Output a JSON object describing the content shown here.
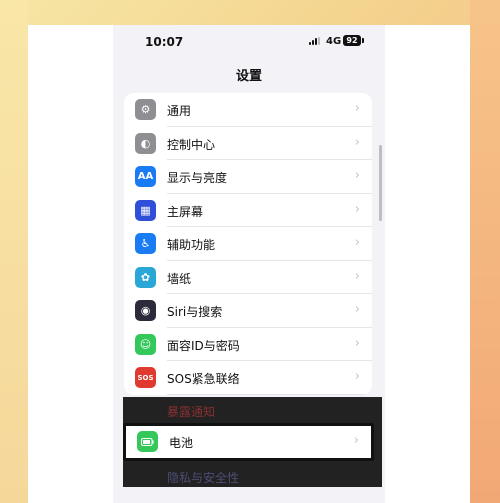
{
  "status": {
    "time": "10:07",
    "network": "4G",
    "battery": "92"
  },
  "nav": {
    "title": "设置"
  },
  "rows": [
    {
      "label": "通用",
      "icon": "gear-icon",
      "color": "#8e8e93",
      "glyph": "⚙"
    },
    {
      "label": "控制中心",
      "icon": "control-center-icon",
      "color": "#8e8e93",
      "glyph": "◐"
    },
    {
      "label": "显示与亮度",
      "icon": "display-brightness-icon",
      "color": "#1a7cf5",
      "glyph": "AA"
    },
    {
      "label": "主屏幕",
      "icon": "home-screen-icon",
      "color": "#2f4fd8",
      "glyph": "▦"
    },
    {
      "label": "辅助功能",
      "icon": "accessibility-icon",
      "color": "#1a7cf5",
      "glyph": "♿"
    },
    {
      "label": "墙纸",
      "icon": "wallpaper-icon",
      "color": "#2aa7d6",
      "glyph": "✿"
    },
    {
      "label": "Siri与搜索",
      "icon": "siri-icon",
      "color": "#2b2b3c",
      "glyph": "◉"
    },
    {
      "label": "面容ID与密码",
      "icon": "face-id-icon",
      "color": "#34c759",
      "glyph": "☺"
    },
    {
      "label": "SOS紧急联络",
      "icon": "sos-icon",
      "color": "#e0392f",
      "glyph": "SOS"
    }
  ],
  "highlight_row": {
    "label": "电池",
    "icon": "battery-icon",
    "color": "#34c759"
  },
  "dimmed": {
    "above": "暴露通知",
    "below": "隐私与安全性"
  }
}
